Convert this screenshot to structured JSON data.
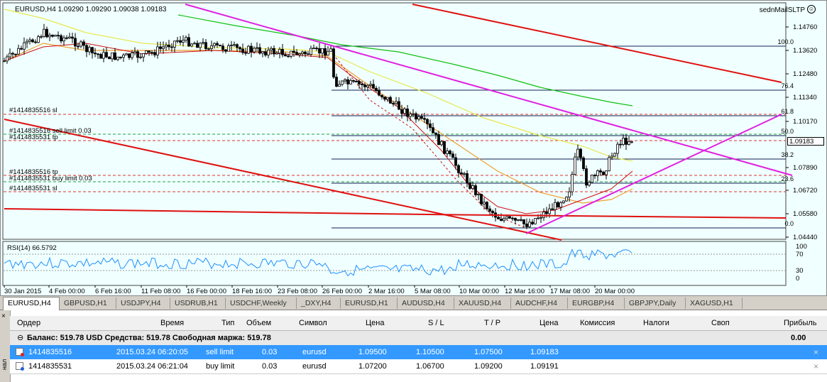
{
  "chart": {
    "symbol_line": "EURUSD,H4  1.09290 1.09290 1.09038 1.09183",
    "ea_name": "sednMailSLTP",
    "ea_icon": "smiley-icon",
    "rsi_label": "RSI(14) 66.5792",
    "price_ticks": [
      "1.14760",
      "1.13620",
      "1.12480",
      "1.11340",
      "1.10170",
      "1.07890",
      "1.06720",
      "1.05580",
      "1.04440"
    ],
    "current_price": "1.09183",
    "rsi_ticks": [
      "100",
      "70",
      "30",
      "0"
    ],
    "time_ticks": [
      "30 Jan 2015",
      "4 Feb 00:00",
      "6 Feb 16:00",
      "11 Feb 08:00",
      "16 Feb 00:00",
      "18 Feb 16:00",
      "23 Feb 08:00",
      "26 Feb 00:00",
      "2 Mar 16:00",
      "5 Mar 08:00",
      "10 Mar 00:00",
      "12 Mar 16:00",
      "17 Mar 08:00",
      "20 Mar 00:00"
    ],
    "fib_levels": [
      "100.0",
      "76.4",
      "61.8",
      "50.0",
      "38.2",
      "23.6",
      "0.0"
    ],
    "order_labels": [
      "#1414835516 sl",
      "#1414835516 sell limit 0.03",
      "#1414835531 tp",
      "#1414835516 tp",
      "#1414835531 buy limit 0.03",
      "#1414835531 sl"
    ],
    "colors": {
      "background": "#f0ffff",
      "trend": "#e01010",
      "magenta": "#e020e0",
      "ma_green": "#10c010",
      "ma_yellow": "#e8e850",
      "ma_orange": "#f0a030",
      "ma_red": "#d01010"
    }
  },
  "tabs": [
    "EURUSD,H4",
    "GBPUSD,H1",
    "USDJPY,H4",
    "USDRUB,H1",
    "USDCHF,Weekly",
    "_DXY,H4",
    "EURUSD,H1",
    "AUDUSD,H4",
    "XAUUSD,H4",
    "AUDCHF,H4",
    "EURGBP,H4",
    "GBPJPY,Daily",
    "XAGUSD,H1"
  ],
  "terminal": {
    "side_close": "×",
    "side_text": "нал",
    "headers": [
      "Ордер",
      "Время",
      "Тип",
      "Объем",
      "Символ",
      "Цена",
      "S / L",
      "T / P",
      "Цена",
      "Комиссия",
      "Налоги",
      "Своп",
      "Прибыль"
    ],
    "balance_text": "Баланс: 519.78 USD  Средства: 519.78  Свободная маржа: 519.78",
    "balance_profit": "0.00",
    "rows": [
      {
        "order": "1414835516",
        "time": "2015.03.24 06:20:05",
        "type": "sell limit",
        "volume": "0.03",
        "symbol": "eurusd",
        "price": "1.09500",
        "sl": "1.10500",
        "tp": "1.07500",
        "cur": "1.09183",
        "close": "×"
      },
      {
        "order": "1414835531",
        "time": "2015.03.24 06:21:04",
        "type": "buy limit",
        "volume": "0.03",
        "symbol": "eurusd",
        "price": "1.07200",
        "sl": "1.06700",
        "tp": "1.09200",
        "cur": "1.09191",
        "close": "×"
      }
    ]
  }
}
